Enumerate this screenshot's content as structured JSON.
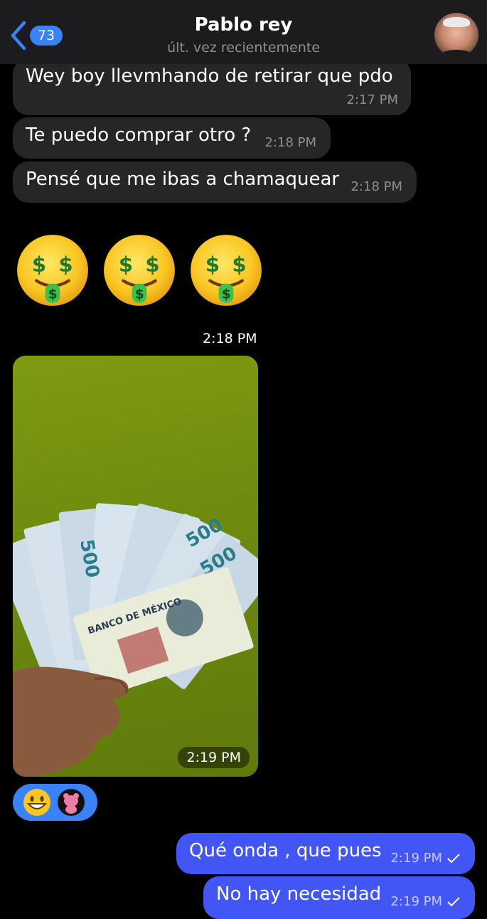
{
  "header": {
    "back_count": "73",
    "contact_name": "Pablo rey",
    "status": "últ. vez recientemente"
  },
  "messages": [
    {
      "text": "Wey boy llevmhando de retirar que pdo",
      "time": "2:17 PM"
    },
    {
      "text": "Te puedo comprar otro ?",
      "time": "2:18 PM"
    },
    {
      "text": "Pensé que me ibas a chamaquear",
      "time": "2:18 PM"
    }
  ],
  "emoji_message": {
    "emoji_name": "money-mouth-face",
    "count": 3,
    "time": "2:18 PM"
  },
  "photo_message": {
    "time": "2:19 PM",
    "banknote_value": "500",
    "bank_text": "BANCO DE MÉXICO"
  },
  "reactions": [
    "grinning-face",
    "pink-panther-sticker"
  ],
  "outgoing": [
    {
      "text": "Qué onda , que pues",
      "time": "2:19 PM"
    },
    {
      "text": "No hay necesidad",
      "time": "2:19 PM"
    }
  ],
  "colors": {
    "accent": "#3a82f7",
    "outgoing_bubble": "#4255f5",
    "incoming_bubble": "#262628",
    "photo_bg": "#7f9a12"
  }
}
